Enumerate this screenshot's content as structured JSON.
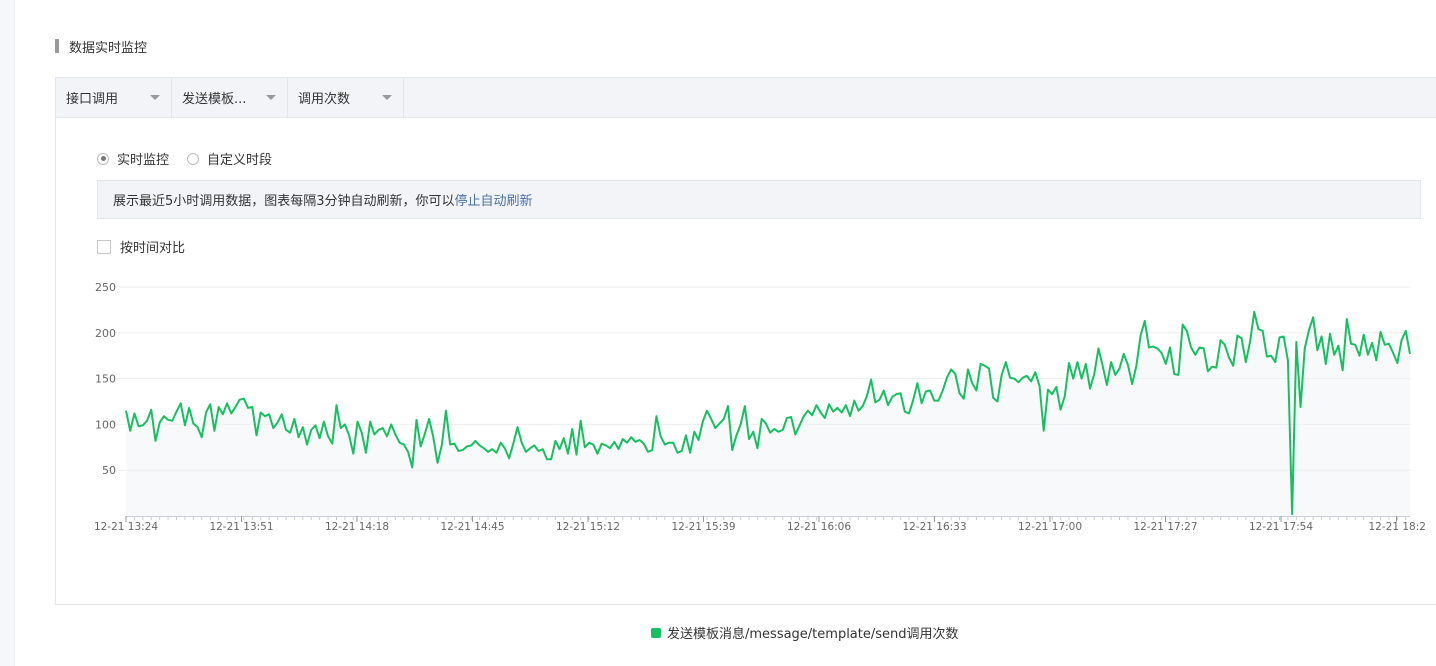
{
  "section": {
    "title": "数据实时监控"
  },
  "filters": [
    {
      "label": "接口调用"
    },
    {
      "label": "发送模板..."
    },
    {
      "label": "调用次数"
    }
  ],
  "mode": {
    "options": [
      "实时监控",
      "自定义时段"
    ],
    "selected": "实时监控"
  },
  "notice": {
    "text": "展示最近5小时调用数据，图表每隔3分钟自动刷新，你可以",
    "link": "停止自动刷新"
  },
  "compare": {
    "label": "按时间对比",
    "checked": false
  },
  "colors": {
    "line": "#16c060",
    "area": "#f8f9fb",
    "grid": "#eeeeee",
    "axis": "#c8cdd6"
  },
  "chart_data": {
    "type": "line",
    "title": "",
    "xlabel": "",
    "ylabel": "",
    "ylim": [
      0,
      250
    ],
    "yticks": [
      50,
      100,
      150,
      200,
      250
    ],
    "xtick_labels": [
      "12-21 13:24",
      "12-21 13:51",
      "12-21 14:18",
      "12-21 14:45",
      "12-21 15:12",
      "12-21 15:39",
      "12-21 16:06",
      "12-21 16:33",
      "12-21 17:00",
      "12-21 17:27",
      "12-21 17:54",
      "12-21 18:2"
    ],
    "grid": true,
    "legend_position": "bottom-center",
    "series": [
      {
        "name": "发送模板消息/message/template/send调用次数",
        "values": [
          115,
          93,
          112,
          98,
          99,
          104,
          116,
          82,
          102,
          109,
          105,
          104,
          114,
          123,
          99,
          118,
          101,
          97,
          86,
          113,
          122,
          93,
          119,
          111,
          123,
          112,
          119,
          127,
          128,
          118,
          119,
          88,
          113,
          109,
          111,
          96,
          102,
          111,
          94,
          91,
          106,
          86,
          97,
          78,
          94,
          99,
          85,
          103,
          87,
          79,
          121,
          96,
          100,
          88,
          68,
          103,
          91,
          69,
          103,
          89,
          94,
          96,
          87,
          100,
          89,
          80,
          78,
          70,
          53,
          105,
          76,
          90,
          106,
          86,
          58,
          77,
          115,
          78,
          79,
          71,
          72,
          76,
          77,
          82,
          77,
          74,
          70,
          73,
          69,
          80,
          74,
          63,
          79,
          97,
          80,
          70,
          74,
          77,
          71,
          73,
          62,
          62,
          82,
          73,
          85,
          68,
          95,
          67,
          104,
          75,
          80,
          78,
          68,
          79,
          77,
          74,
          81,
          73,
          84,
          80,
          86,
          81,
          83,
          79,
          70,
          72,
          109,
          87,
          78,
          80,
          80,
          69,
          71,
          88,
          69,
          92,
          83,
          103,
          115,
          106,
          96,
          101,
          106,
          120,
          72,
          88,
          100,
          120,
          84,
          92,
          74,
          106,
          101,
          91,
          95,
          92,
          94,
          107,
          108,
          89,
          99,
          109,
          115,
          110,
          121,
          113,
          107,
          122,
          114,
          118,
          113,
          121,
          109,
          126,
          115,
          120,
          131,
          149,
          124,
          127,
          137,
          121,
          130,
          133,
          134,
          114,
          112,
          127,
          145,
          123,
          136,
          137,
          126,
          126,
          137,
          151,
          160,
          155,
          134,
          128,
          160,
          145,
          137,
          166,
          164,
          161,
          129,
          125,
          154,
          168,
          151,
          150,
          146,
          151,
          153,
          147,
          157,
          142,
          93,
          138,
          133,
          141,
          116,
          131,
          167,
          150,
          168,
          150,
          166,
          139,
          155,
          183,
          164,
          143,
          168,
          154,
          161,
          177,
          165,
          144,
          164,
          197,
          213,
          184,
          185,
          183,
          178,
          166,
          184,
          155,
          154,
          209,
          202,
          184,
          176,
          184,
          183,
          158,
          163,
          162,
          192,
          187,
          173,
          164,
          197,
          194,
          168,
          190,
          223,
          204,
          202,
          174,
          175,
          168,
          195,
          196,
          170,
          2,
          190,
          119,
          183,
          203,
          217,
          181,
          196,
          166,
          199,
          176,
          186,
          159,
          215,
          188,
          187,
          175,
          198,
          176,
          189,
          170,
          201,
          187,
          188,
          178,
          167,
          192,
          202,
          177
        ]
      }
    ]
  }
}
